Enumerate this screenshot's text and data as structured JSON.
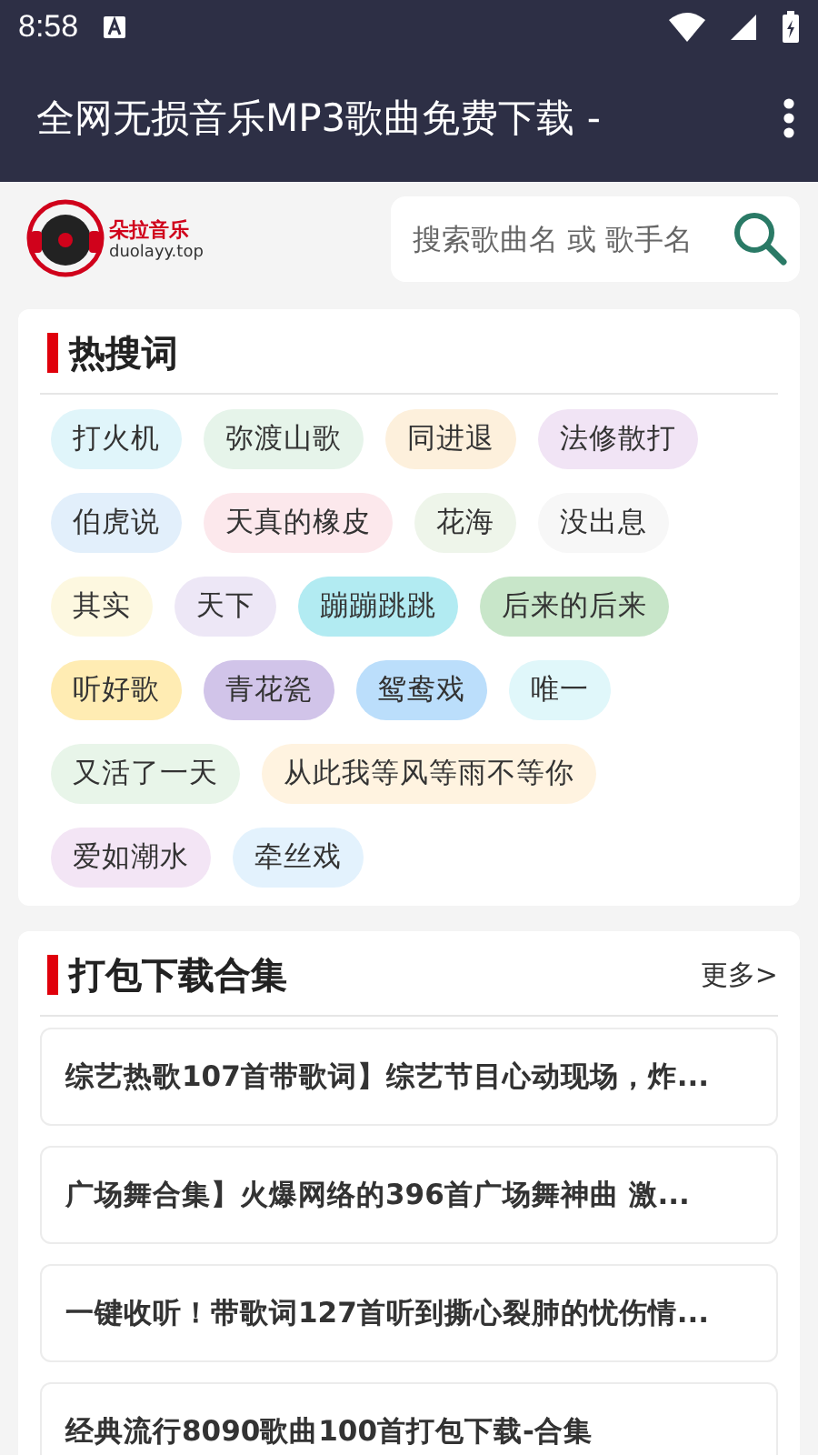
{
  "status_bar": {
    "time": "8:58"
  },
  "app_bar": {
    "title": "全网无损音乐MP3歌曲免费下载 -"
  },
  "header": {
    "logo_name": "朵拉音乐",
    "logo_site": "duolayy.top",
    "search": {
      "placeholder": "搜索歌曲名 或 歌手名"
    }
  },
  "hot_words": {
    "title": "热搜词",
    "tags": [
      {
        "label": "打火机",
        "color": "#e0f5fa"
      },
      {
        "label": "弥渡山歌",
        "color": "#e6f4ea"
      },
      {
        "label": "同进退",
        "color": "#fdf0dc"
      },
      {
        "label": "法修散打",
        "color": "#f1e4f5"
      },
      {
        "label": "伯虎说",
        "color": "#e2effb"
      },
      {
        "label": "天真的橡皮",
        "color": "#fce8ec"
      },
      {
        "label": "花海",
        "color": "#eef5ea"
      },
      {
        "label": "没出息",
        "color": "#f7f7f7"
      },
      {
        "label": "其实",
        "color": "#fdf8e0"
      },
      {
        "label": "天下",
        "color": "#ede7f6"
      },
      {
        "label": "蹦蹦跳跳",
        "color": "#b2ebf2"
      },
      {
        "label": "后来的后来",
        "color": "#c8e6c9"
      },
      {
        "label": "听好歌",
        "color": "#ffecb3"
      },
      {
        "label": "青花瓷",
        "color": "#d1c4e9"
      },
      {
        "label": "鸳鸯戏",
        "color": "#bbdefb"
      },
      {
        "label": "唯一",
        "color": "#e0f7fa"
      },
      {
        "label": "又活了一天",
        "color": "#e8f5e9"
      },
      {
        "label": "从此我等风等雨不等你",
        "color": "#fff3e0"
      },
      {
        "label": "爱如潮水",
        "color": "#f3e5f5"
      },
      {
        "label": "牵丝戏",
        "color": "#e3f2fd"
      }
    ]
  },
  "packs": {
    "title": "打包下载合集",
    "more": "更多>",
    "items": [
      "综艺热歌107首带歌词】综艺节目心动现场，炸...",
      "广场舞合集】火爆网络的396首广场舞神曲 激...",
      "一键收听！带歌词127首听到撕心裂肺的忧伤情...",
      "经典流行8090歌曲100首打包下载-合集"
    ]
  }
}
